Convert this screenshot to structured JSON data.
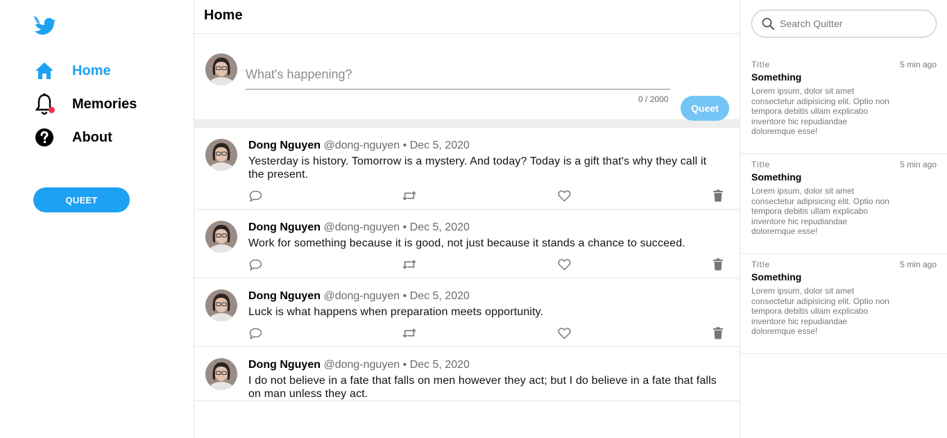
{
  "colors": {
    "accent": "#1da1f2",
    "accent_light": "#74c4f6",
    "notification": "#f2314a"
  },
  "sidebar": {
    "logo": "bird-logo-icon",
    "items": [
      {
        "label": "Home",
        "icon": "home-icon",
        "active": true
      },
      {
        "label": "Memories",
        "icon": "bell-icon",
        "active": false
      },
      {
        "label": "About",
        "icon": "help-circle-icon",
        "active": false
      }
    ],
    "queet_button": "QUEET"
  },
  "header": {
    "title": "Home"
  },
  "compose": {
    "placeholder": "What's happening?",
    "counter": "0 / 2000",
    "button": "Queet"
  },
  "posts": [
    {
      "name": "Dong Nguyen",
      "handle": "@dong-nguyen",
      "date": "• Dec 5, 2020",
      "text": "Yesterday is history. Tomorrow is a mystery. And today? Today is a gift that's why they call it the present."
    },
    {
      "name": "Dong Nguyen",
      "handle": "@dong-nguyen",
      "date": "• Dec 5, 2020",
      "text": "Work for something because it is good, not just because it stands a chance to succeed."
    },
    {
      "name": "Dong Nguyen",
      "handle": "@dong-nguyen",
      "date": "• Dec 5, 2020",
      "text": "Luck is what happens when preparation meets opportunity."
    },
    {
      "name": "Dong Nguyen",
      "handle": "@dong-nguyen",
      "date": "• Dec 5, 2020",
      "text": "I do not believe in a fate that falls on men however they act; but I do believe in a fate that falls on man unless they act."
    }
  ],
  "search": {
    "placeholder": "Search Quitter"
  },
  "news": [
    {
      "title": "Title",
      "time": "5 min ago",
      "headline": "Something",
      "body": "Lorem ipsum, dolor sit amet consectetur adipisicing elit. Optio non tempora debitis ullam explicabo inventore hic repudiandae doloremque esse!"
    },
    {
      "title": "Title",
      "time": "5 min ago",
      "headline": "Something",
      "body": "Lorem ipsum, dolor sit amet consectetur adipisicing elit. Optio non tempora debitis ullam explicabo inventore hic repudiandae doloremque esse!"
    },
    {
      "title": "Title",
      "time": "5 min ago",
      "headline": "Something",
      "body": "Lorem ipsum, dolor sit amet consectetur adipisicing elit. Optio non tempora debitis ullam explicabo inventore hic repudiandae doloremque esse!"
    }
  ]
}
